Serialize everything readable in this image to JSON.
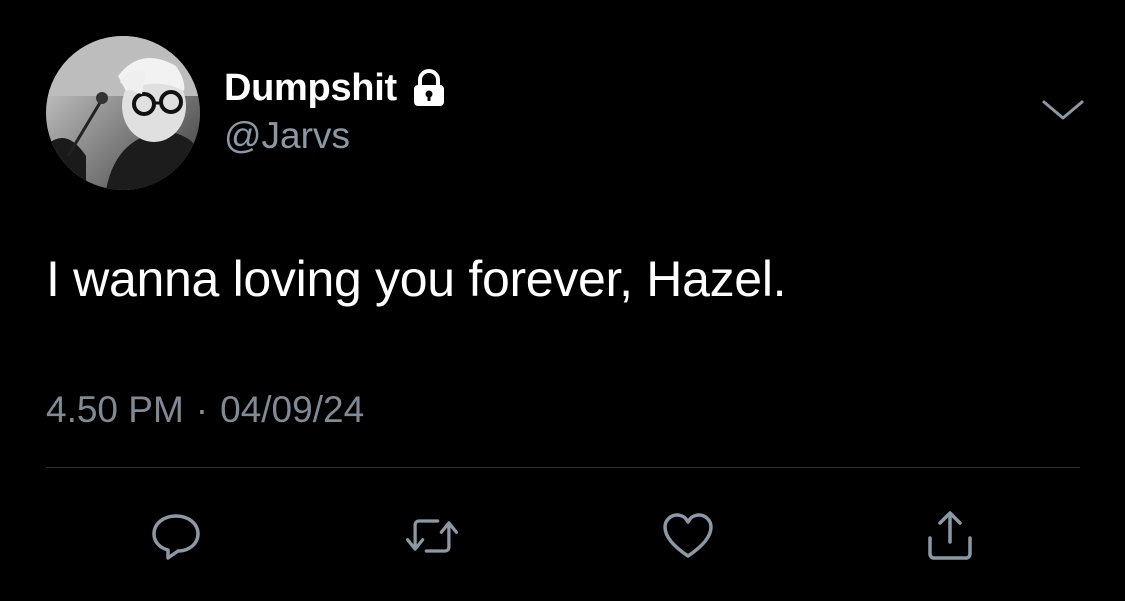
{
  "user": {
    "display_name": "Dumpshit",
    "handle": "@Jarvs",
    "protected_icon": "lock-icon",
    "avatar": "profile-photo"
  },
  "header": {
    "menu_icon": "chevron-down-icon"
  },
  "tweet": {
    "text": "I wanna loving you forever, Hazel.",
    "time": "4.50 PM",
    "separator": "·",
    "date": "04/09/24"
  },
  "actions": [
    {
      "name": "reply",
      "icon": "speech-bubble-icon"
    },
    {
      "name": "retweet",
      "icon": "retweet-icon"
    },
    {
      "name": "like",
      "icon": "heart-icon"
    },
    {
      "name": "share",
      "icon": "share-icon"
    }
  ],
  "colors": {
    "background": "#000000",
    "text": "#ffffff",
    "secondary": "#8b98a5",
    "icon": "#8b98a5",
    "divider": "#2f3336"
  }
}
